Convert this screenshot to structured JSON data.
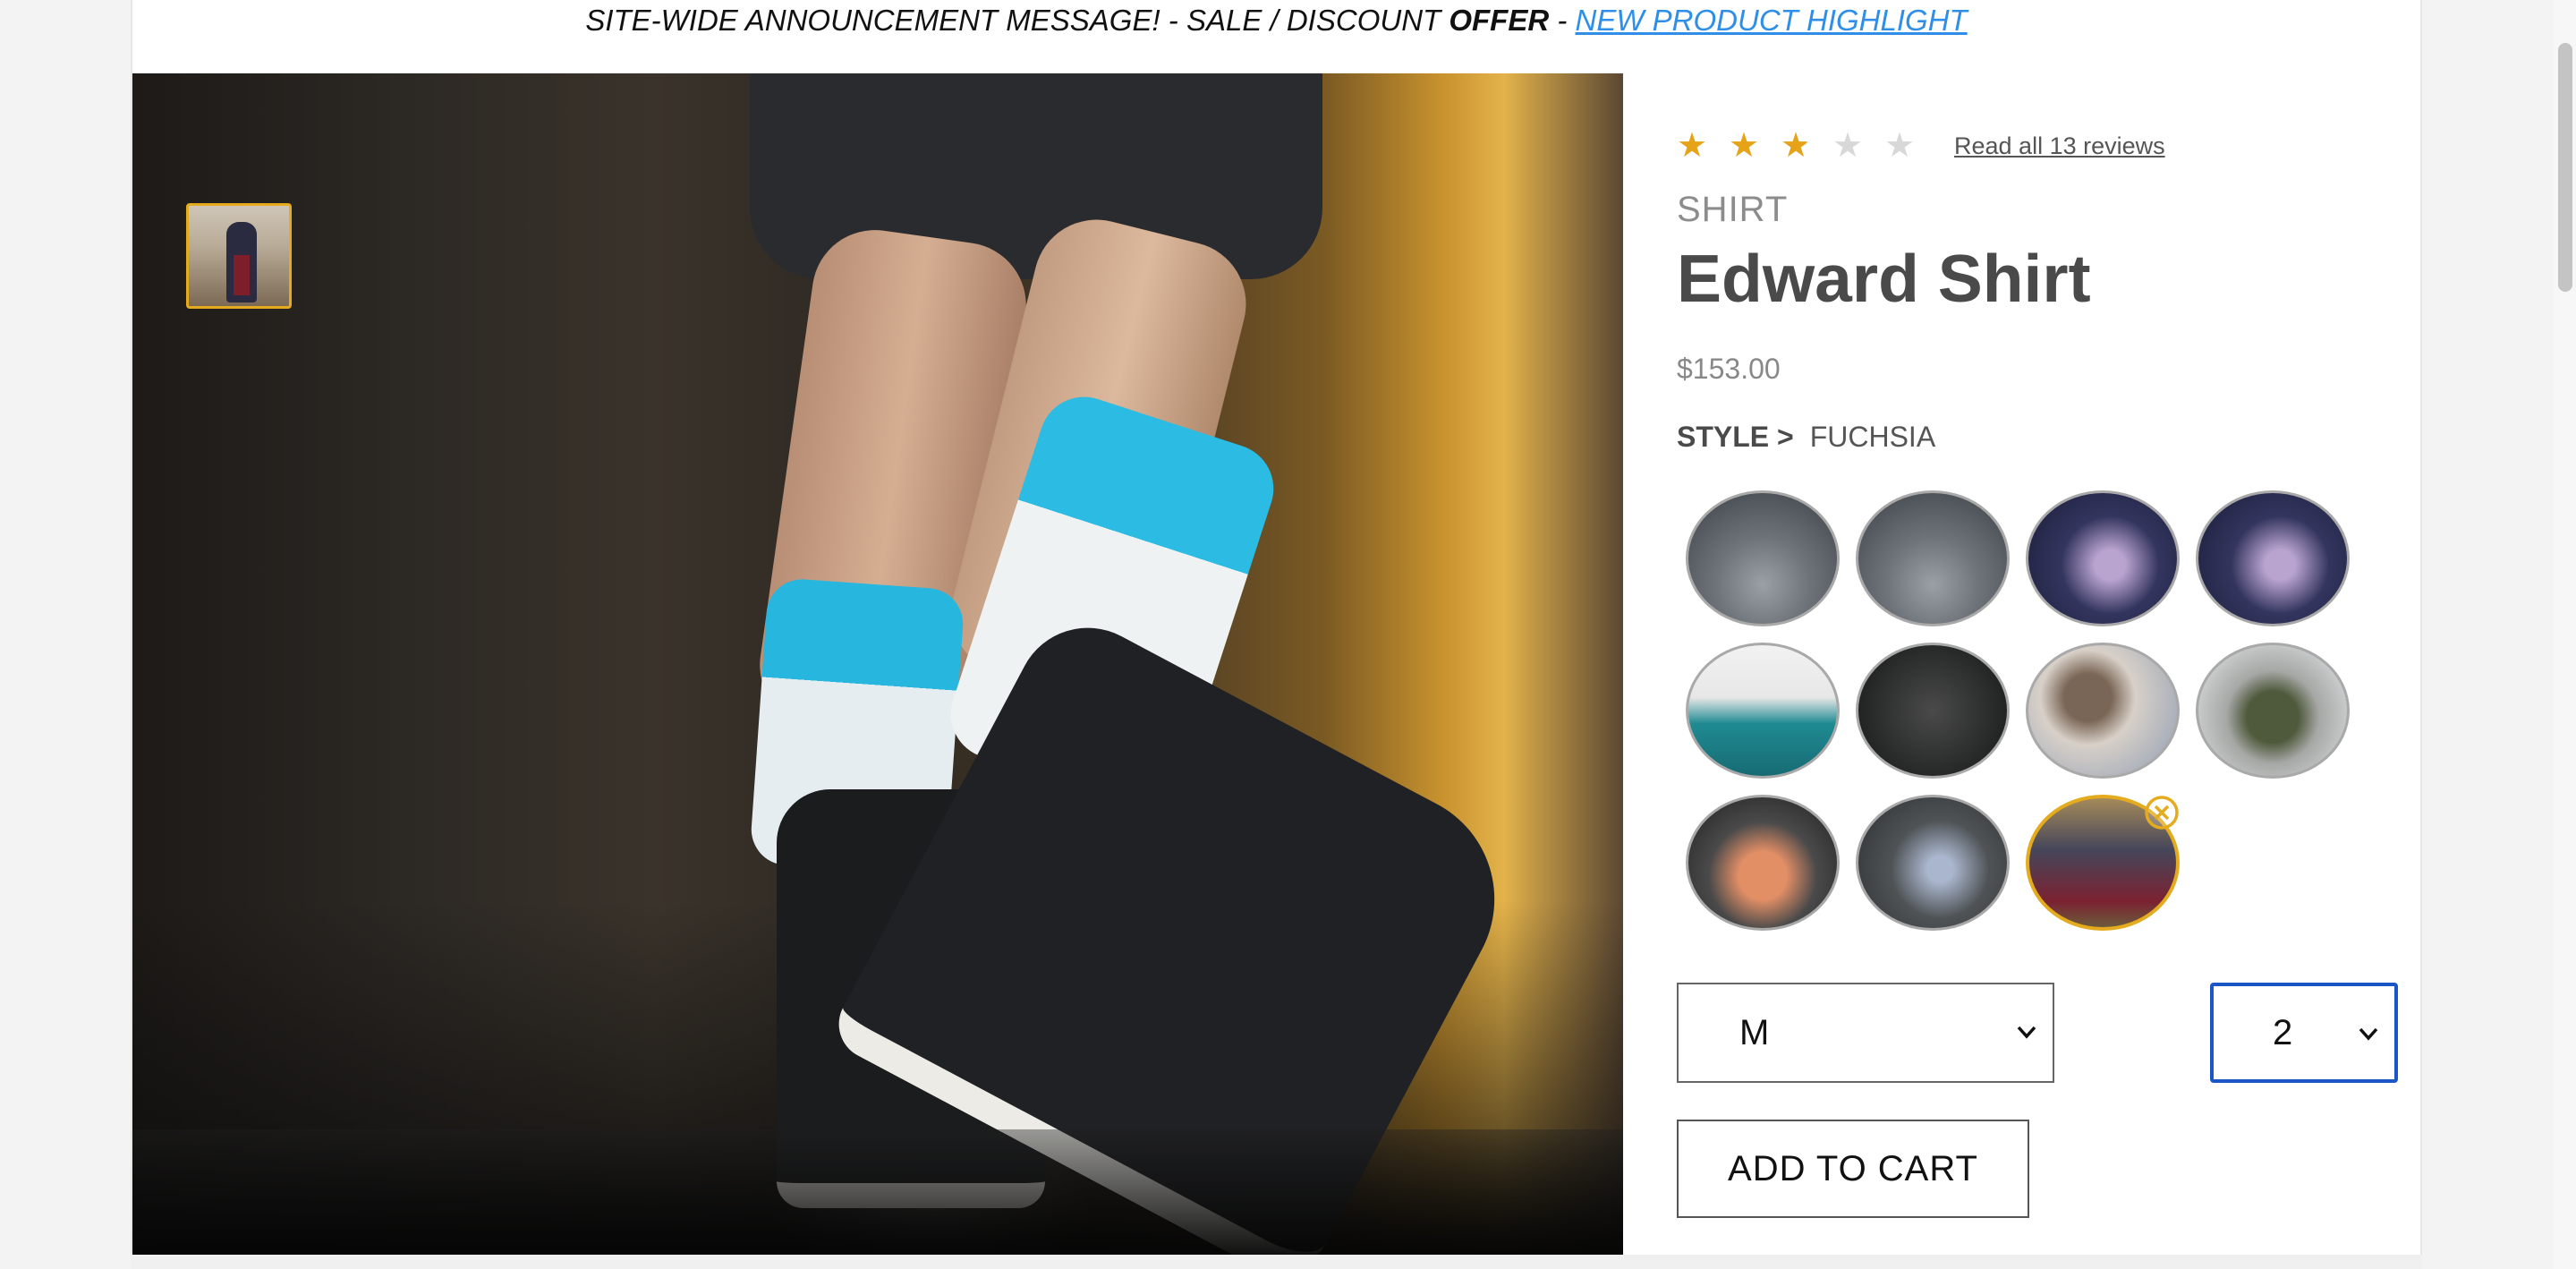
{
  "announcement": {
    "prefix": "SITE-WIDE ANNOUNCEMENT MESSAGE! - SALE / DISCOUNT ",
    "offer": "OFFER",
    "separator": " - ",
    "link": "NEW PRODUCT HIGHLIGHT"
  },
  "product": {
    "rating": 2.5,
    "rating_max": 5,
    "stars": [
      "full",
      "full",
      "half",
      "empty",
      "empty"
    ],
    "reviews_link": "Read all 13 reviews",
    "category": "SHIRT",
    "name": "Edward Shirt",
    "price": "$153.00",
    "style_label": "STYLE >",
    "style_value": "FUCHSIA"
  },
  "gallery": {
    "main_image": "sneakers-photo",
    "thumbnails": [
      "coat-person-thumbnail"
    ]
  },
  "styles": [
    {
      "name": "style-sneaker-gray-1",
      "theme": "sw-gray"
    },
    {
      "name": "style-sneaker-gray-2",
      "theme": "sw-gray"
    },
    {
      "name": "style-sneaker-navy-1",
      "theme": "sw-navy"
    },
    {
      "name": "style-sneaker-navy-2",
      "theme": "sw-navy"
    },
    {
      "name": "style-man-couch",
      "theme": "sw-teal"
    },
    {
      "name": "style-man-dark",
      "theme": "sw-dark"
    },
    {
      "name": "style-camo-jacket",
      "theme": "sw-camo"
    },
    {
      "name": "style-snow-camo",
      "theme": "sw-snow"
    },
    {
      "name": "style-sneaker-orange",
      "theme": "sw-orange"
    },
    {
      "name": "style-street-sneaker",
      "theme": "sw-street"
    },
    {
      "name": "style-coat",
      "theme": "sw-coat",
      "selected": true
    }
  ],
  "size_select": {
    "value": "M"
  },
  "quantity_select": {
    "value": "2"
  },
  "add_to_cart_label": "ADD TO CART",
  "colors": {
    "accent": "#e4ab1e",
    "link": "#2f8fe8",
    "focus": "#1b56c7",
    "title": "#4a4a4a",
    "muted": "#8c8c8c"
  }
}
